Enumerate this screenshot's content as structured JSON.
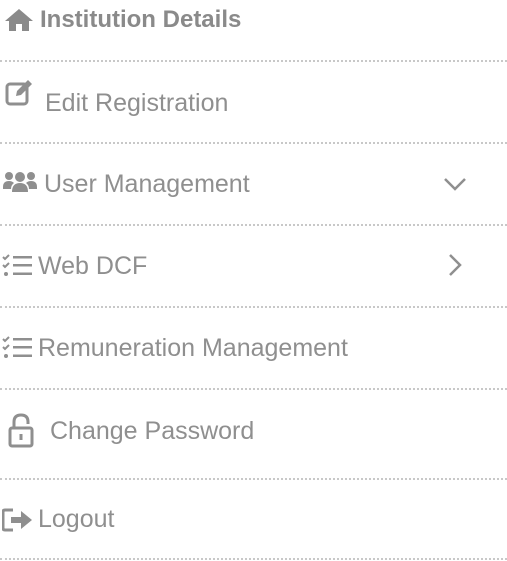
{
  "menu": {
    "items": [
      {
        "label": "Institution Details",
        "icon": "home-icon"
      },
      {
        "label": "Edit Registration",
        "icon": "edit-icon"
      },
      {
        "label": "User Management",
        "icon": "users-icon",
        "expand": "chevron-down-icon"
      },
      {
        "label": "Web DCF",
        "icon": "list-check-icon",
        "expand": "chevron-right-icon"
      },
      {
        "label": "Remuneration Management",
        "icon": "list-check-icon"
      },
      {
        "label": "Change Password",
        "icon": "lock-icon"
      },
      {
        "label": "Logout",
        "icon": "logout-icon"
      }
    ]
  },
  "colors": {
    "text": "#8f8f8f",
    "divider": "#c8c8c8",
    "background": "#ffffff"
  }
}
